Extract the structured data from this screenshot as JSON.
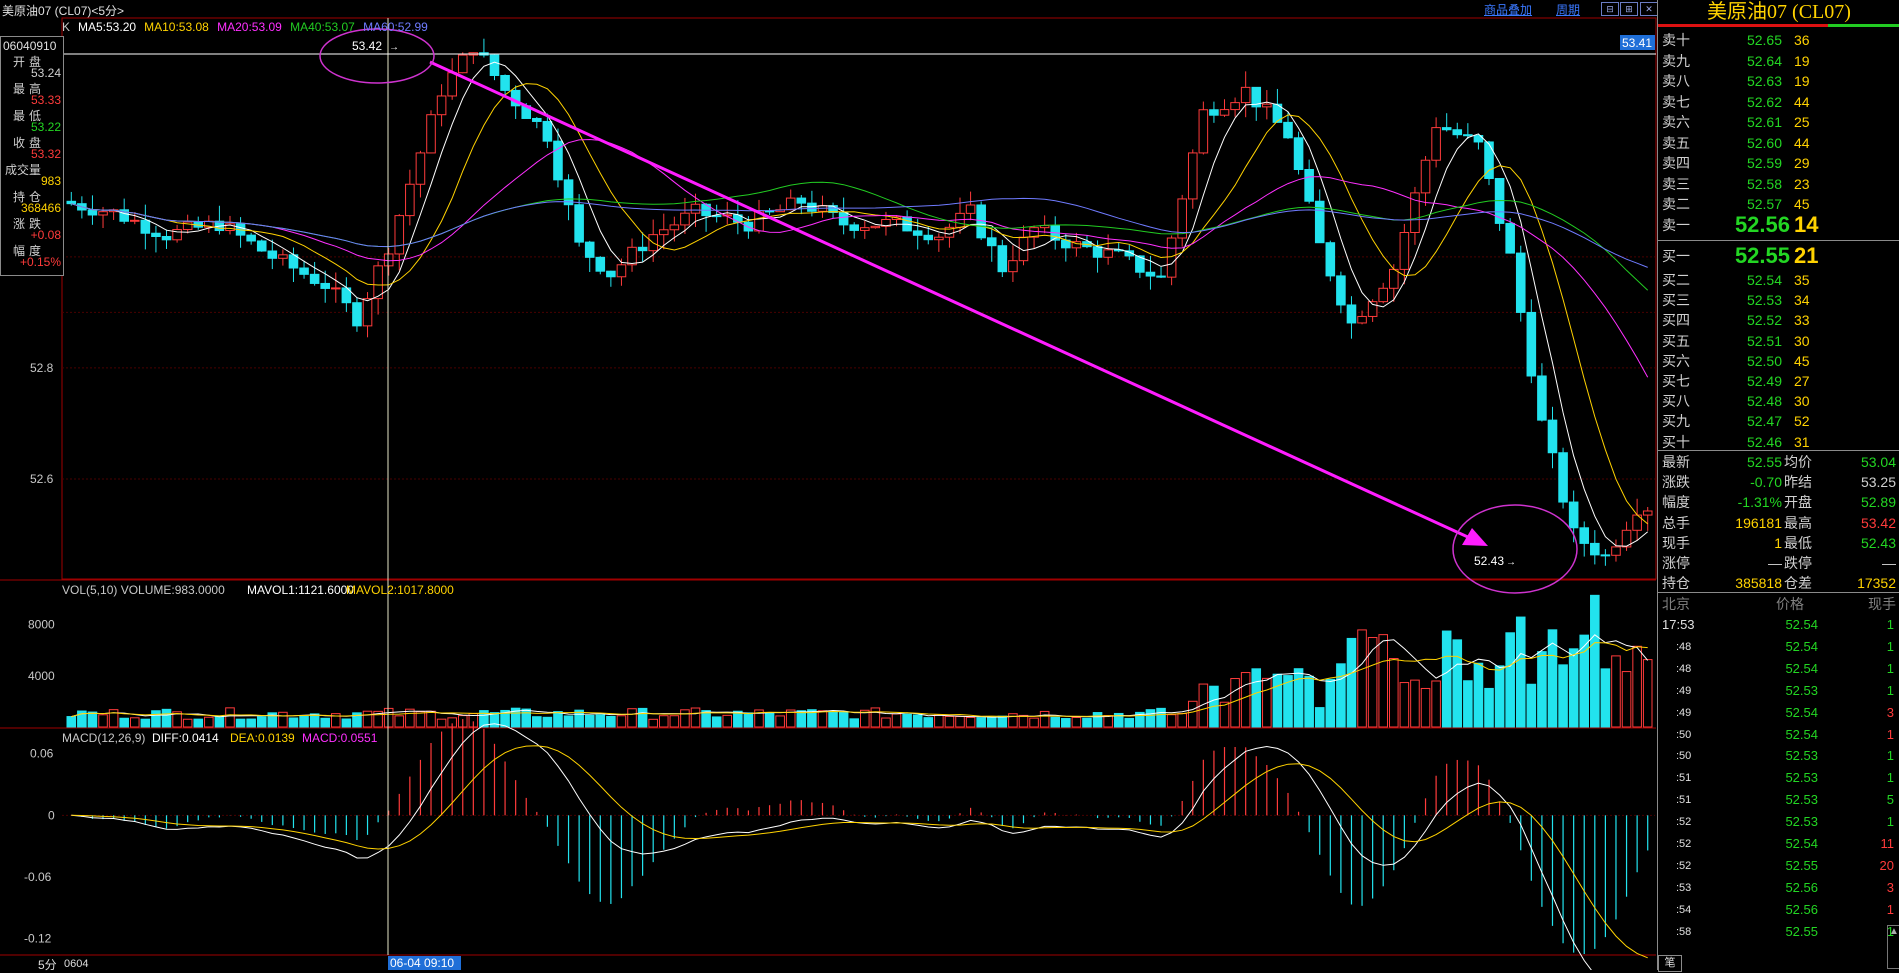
{
  "instrument": {
    "name_full": "美原油07 (CL07)",
    "name_short": "美原油07 (CL07)<5分>",
    "timeframe": "5分",
    "date_code": "06040910",
    "cursor_time": "06-04 09:10",
    "bottom_left": "0604"
  },
  "toolbar": {
    "overlay_label": "商品叠加",
    "period_label": "周期",
    "k_label": "K"
  },
  "ma_legend": [
    {
      "text": "MA5:53.20",
      "color": "#ffffff"
    },
    {
      "text": "MA10:53.08",
      "color": "#ffd200"
    },
    {
      "text": "MA20:53.09",
      "color": "#ff30ff"
    },
    {
      "text": "MA40:53.07",
      "color": "#22cc22"
    },
    {
      "text": "MA60:52.99",
      "color": "#6f7bff"
    }
  ],
  "info_panel": {
    "open_label": "开盘",
    "open": "53.24",
    "high_label": "最高",
    "high": "53.33",
    "low_label": "最低",
    "low": "53.22",
    "close_label": "收盘",
    "close": "53.32",
    "vol_label": "成交量",
    "vol": "983",
    "oi_label": "持仓",
    "oi": "368466",
    "chg_label": "涨跌",
    "chg": "+0.08",
    "pct_label": "幅度",
    "pct": "+0.15%"
  },
  "annotations": {
    "high_mark": "53.42",
    "low_mark": "52.43",
    "last_price_tag": "53.41"
  },
  "price_axis": [
    "52.8",
    "52.6"
  ],
  "volume": {
    "legend_prefix": "VOL(5,10) VOLUME:983.0000",
    "mavol1": "MAVOL1:1121.6000",
    "mavol2": "MAVOL2:1017.8000",
    "axis": [
      "8000",
      "4000"
    ]
  },
  "macd": {
    "legend_prefix": "MACD(12,26,9)",
    "diff": "DIFF:0.0414",
    "dea": "DEA:0.0139",
    "macd": "MACD:0.0551",
    "axis": [
      "0.06",
      "0",
      "-0.06",
      "-0.12"
    ]
  },
  "order_book": {
    "asks": [
      {
        "label": "卖十",
        "price": "52.65",
        "vol": "36"
      },
      {
        "label": "卖九",
        "price": "52.64",
        "vol": "19"
      },
      {
        "label": "卖八",
        "price": "52.63",
        "vol": "19"
      },
      {
        "label": "卖七",
        "price": "52.62",
        "vol": "44"
      },
      {
        "label": "卖六",
        "price": "52.61",
        "vol": "25"
      },
      {
        "label": "卖五",
        "price": "52.60",
        "vol": "44"
      },
      {
        "label": "卖四",
        "price": "52.59",
        "vol": "29"
      },
      {
        "label": "卖三",
        "price": "52.58",
        "vol": "23"
      },
      {
        "label": "卖二",
        "price": "52.57",
        "vol": "45"
      }
    ],
    "ask1": {
      "label": "卖一",
      "price": "52.56",
      "vol": "14"
    },
    "bid1": {
      "label": "买一",
      "price": "52.55",
      "vol": "21"
    },
    "bids": [
      {
        "label": "买二",
        "price": "52.54",
        "vol": "35"
      },
      {
        "label": "买三",
        "price": "52.53",
        "vol": "34"
      },
      {
        "label": "买四",
        "price": "52.52",
        "vol": "33"
      },
      {
        "label": "买五",
        "price": "52.51",
        "vol": "30"
      },
      {
        "label": "买六",
        "price": "52.50",
        "vol": "45"
      },
      {
        "label": "买七",
        "price": "52.49",
        "vol": "27"
      },
      {
        "label": "买八",
        "price": "52.48",
        "vol": "30"
      },
      {
        "label": "买九",
        "price": "52.47",
        "vol": "52"
      },
      {
        "label": "买十",
        "price": "52.46",
        "vol": "31"
      }
    ]
  },
  "stats": [
    {
      "l1": "最新",
      "v1": "52.55",
      "c1": "#23d623",
      "l2": "均价",
      "v2": "53.04",
      "c2": "#23d623"
    },
    {
      "l1": "涨跌",
      "v1": "-0.70",
      "c1": "#23d623",
      "l2": "昨结",
      "v2": "53.25",
      "c2": "#d0d0d0"
    },
    {
      "l1": "幅度",
      "v1": "-1.31%",
      "c1": "#23d623",
      "l2": "开盘",
      "v2": "52.89",
      "c2": "#23d623"
    },
    {
      "l1": "总手",
      "v1": "196181",
      "c1": "#ffd200",
      "l2": "最高",
      "v2": "53.42",
      "c2": "#ff3b3b"
    },
    {
      "l1": "现手",
      "v1": "1",
      "c1": "#ffd200",
      "l2": "最低",
      "v2": "52.43",
      "c2": "#23d623"
    },
    {
      "l1": "涨停",
      "v1": "—",
      "c1": "#d0d0d0",
      "l2": "跌停",
      "v2": "—",
      "c2": "#d0d0d0"
    },
    {
      "l1": "持仓",
      "v1": "385818",
      "c1": "#ffd200",
      "l2": "仓差",
      "v2": "17352",
      "c2": "#ffd200"
    }
  ],
  "ticks_header": {
    "time": "北京",
    "price": "价格",
    "vol": "现手"
  },
  "ticks": [
    {
      "time": "17:53",
      "price": "52.54",
      "vol": "1",
      "color": "#23d623"
    },
    {
      "time": ":48",
      "price": "52.54",
      "vol": "1",
      "color": "#23d623"
    },
    {
      "time": ":48",
      "price": "52.54",
      "vol": "1",
      "color": "#23d623"
    },
    {
      "time": ":49",
      "price": "52.53",
      "vol": "1",
      "color": "#23d623"
    },
    {
      "time": ":49",
      "price": "52.54",
      "vol": "3",
      "color": "#ff3b3b"
    },
    {
      "time": ":50",
      "price": "52.54",
      "vol": "1",
      "color": "#ff3b3b"
    },
    {
      "time": ":50",
      "price": "52.53",
      "vol": "1",
      "color": "#23d623"
    },
    {
      "time": ":51",
      "price": "52.53",
      "vol": "1",
      "color": "#23d623"
    },
    {
      "time": ":51",
      "price": "52.53",
      "vol": "5",
      "color": "#23d623"
    },
    {
      "time": ":52",
      "price": "52.53",
      "vol": "1",
      "color": "#23d623"
    },
    {
      "time": ":52",
      "price": "52.54",
      "vol": "11",
      "color": "#ff3b3b"
    },
    {
      "time": ":52",
      "price": "52.55",
      "vol": "20",
      "color": "#ff3b3b"
    },
    {
      "time": ":53",
      "price": "52.56",
      "vol": "3",
      "color": "#ff3b3b"
    },
    {
      "time": ":54",
      "price": "52.56",
      "vol": "1",
      "color": "#ff3b3b"
    },
    {
      "time": ":58",
      "price": "52.55",
      "vol": "1",
      "color": "#23d623"
    }
  ],
  "bottom_tab": "笔",
  "colors": {
    "up": "#ff3b3b",
    "down": "#22e3ee",
    "ask_price": "#23d623",
    "vol_yellow": "#ffd200"
  },
  "chart_data": {
    "type": "candlestick",
    "title": "美原油07 (CL07) 5分",
    "y_axis_ticks": [
      52.8,
      52.6
    ],
    "y_range": [
      52.42,
      53.43
    ],
    "bars_approx": 95,
    "price_high": 53.42,
    "price_low": 52.43,
    "last": 52.55,
    "trend_arrow": {
      "from": 53.42,
      "to": 52.43
    }
  }
}
